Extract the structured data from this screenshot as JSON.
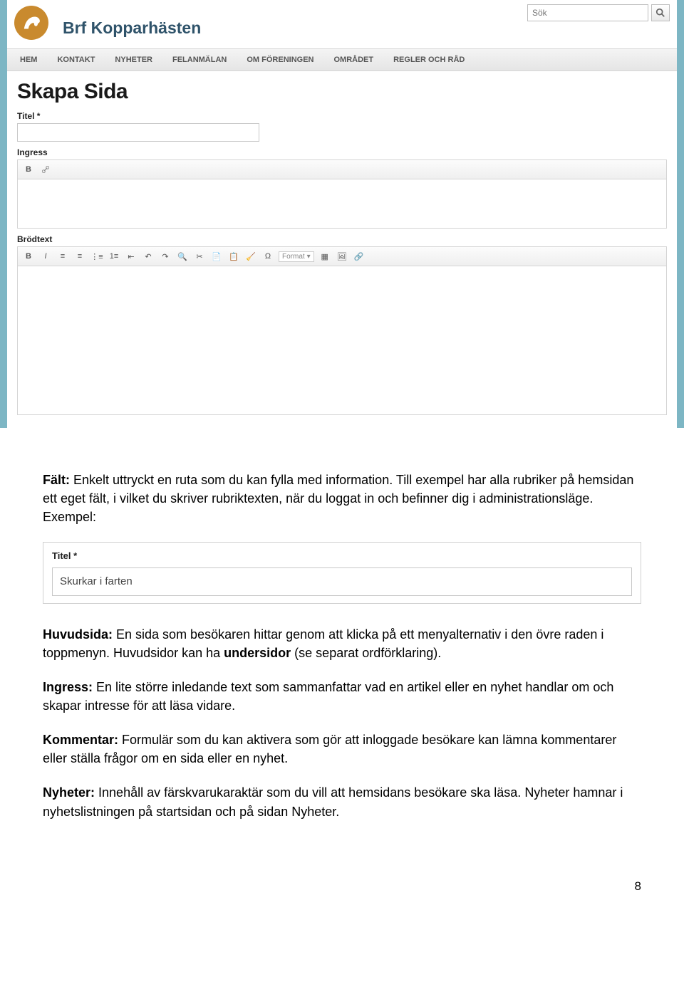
{
  "search": {
    "placeholder": "Sök"
  },
  "site_title": "Brf Kopparhästen",
  "nav": [
    "HEM",
    "KONTAKT",
    "NYHETER",
    "FELANMÄLAN",
    "OM FÖRENINGEN",
    "OMRÅDET",
    "REGLER OCH RÅD"
  ],
  "page_heading": "Skapa Sida",
  "labels": {
    "titel": "Titel *",
    "ingress": "Ingress",
    "brodtext": "Brödtext",
    "format": "Format"
  },
  "definitions": {
    "falt_label": "Fält:",
    "falt_body": " Enkelt uttryckt en ruta som du kan fylla med information. Till exempel har alla rubriker på hemsidan ett eget fält, i vilket du skriver rubriktexten, när du loggat in och befinner dig i administrationsläge. Exempel:",
    "huvudsida_label": "Huvudsida:",
    "huvudsida_body_a": " En sida som besökaren hittar genom att klicka på ett menyalternativ i den övre raden i toppmenyn. Huvudsidor kan ha ",
    "huvudsida_bold": "undersidor",
    "huvudsida_body_b": " (se separat ordförklaring).",
    "ingress_label": "Ingress:",
    "ingress_body": " En lite större inledande text som sammanfattar vad en artikel eller en nyhet handlar om och skapar intresse för att läsa vidare.",
    "kommentar_label": "Kommentar:",
    "kommentar_body": " Formulär som du kan aktivera som gör att inloggade besökare kan lämna kommentarer eller ställa frågor om en sida eller en nyhet.",
    "nyheter_label": "Nyheter:",
    "nyheter_body": " Innehåll av färskvarukaraktär som du vill att hemsidans besökare ska läsa. Nyheter hamnar i nyhetslistningen på startsidan och på sidan Nyheter."
  },
  "example": {
    "label": "Titel *",
    "value": "Skurkar i farten"
  },
  "page_number": "8"
}
